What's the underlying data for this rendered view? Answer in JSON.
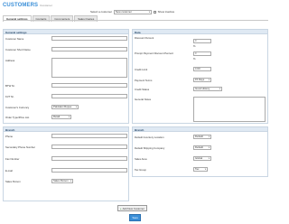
{
  "header": {
    "title": "CUSTOMERS",
    "subtitle": "Customer"
  },
  "top": {
    "select_label": "Select a customer",
    "select_value": "New customer",
    "checkbox_label": "Show inactive"
  },
  "tabs": [
    {
      "label": "General settings"
    },
    {
      "label": "Contacts"
    },
    {
      "label": "Cost centers"
    },
    {
      "label": "Sales Quotes"
    }
  ],
  "general": {
    "header": "General settings",
    "customer_name": "Customer Name",
    "customer_short_name": "Customer Short Name",
    "address": "Address",
    "btw_nr": "BTW Nr.",
    "kvt_nr": "KVT Nr.",
    "currency_label": "Customer's Currency",
    "currency_value": "Pakistani Rupee",
    "order_type_label": "Order Type/Price List",
    "order_type_value": "Retail"
  },
  "data": {
    "header": "Data",
    "discount_label": "Discount Percent",
    "discount_value": "0",
    "prompt_label": "Prompt Payment Discount Percent",
    "prompt_value": "0",
    "credit_label": "Credit Limit",
    "credit_value": "1000",
    "payment_label": "Payment Terms",
    "payment_value": "15 Days",
    "status_label": "Credit Status",
    "status_value": "Good History",
    "notes_label": "General Notes",
    "pct_symbol": "%"
  },
  "branch": {
    "header": "Branch",
    "phone": "Phone",
    "secondary_phone": "Secondary Phone Number",
    "fax": "Fax Number",
    "email": "E-mail",
    "sales_person_label": "Sales Person",
    "sales_person_value": "Sales Person"
  },
  "defaults": {
    "header": "Branch",
    "inventory_label": "Default Inventory Location",
    "inventory_value": "Default",
    "shipping_label": "Default Shipping Company",
    "shipping_value": "Default",
    "sales_area_label": "Sales Area",
    "sales_area_value": "Global",
    "tax_group_label": "Tax Group",
    "tax_group_value": "Tax"
  },
  "actions": {
    "add_label": "Add New Customer",
    "save_label": "Save"
  }
}
